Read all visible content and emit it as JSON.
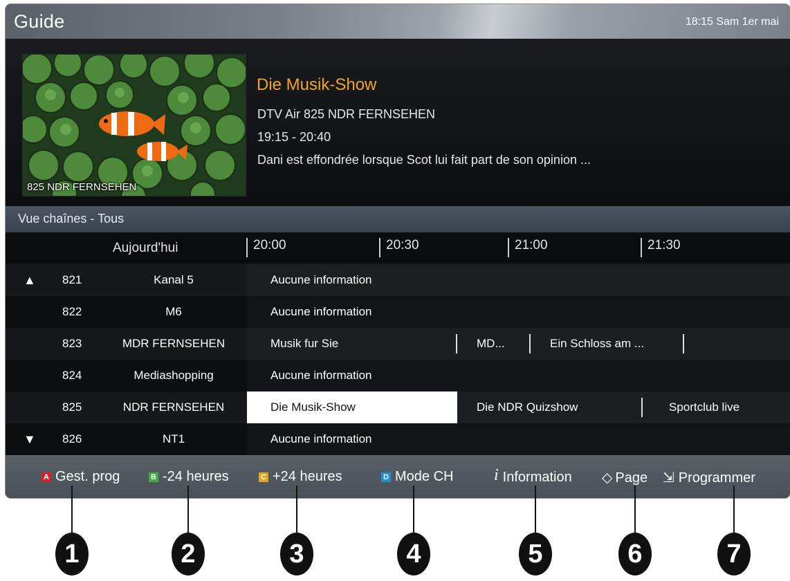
{
  "header": {
    "title": "Guide",
    "clock": "18:15 Sam 1er mai"
  },
  "preview": {
    "channel_label": "825 NDR FERNSEHEN",
    "program_title": "Die Musik-Show",
    "channel_info": "DTV Air 825 NDR FERNSEHEN",
    "time_range": "19:15 - 20:40",
    "description": "Dani est effondrée lorsque Scot lui fait part de son opinion ..."
  },
  "section": {
    "label": "Vue chaînes - Tous"
  },
  "timeline": {
    "today": "Aujourd'hui",
    "slots": [
      "20:00",
      "20:30",
      "21:00",
      "21:30"
    ]
  },
  "channels": [
    {
      "arrow": "▲",
      "num": "821",
      "name": "Kanal 5",
      "programs": [
        "Aucune information"
      ]
    },
    {
      "arrow": "",
      "num": "822",
      "name": "M6",
      "programs": [
        "Aucune information"
      ]
    },
    {
      "arrow": "",
      "num": "823",
      "name": "MDR FERNSEHEN",
      "programs": [
        "Musik fur Sie",
        "MD...",
        "Ein Schloss am ..."
      ]
    },
    {
      "arrow": "",
      "num": "824",
      "name": "Mediashopping",
      "programs": [
        "Aucune information"
      ]
    },
    {
      "arrow": "",
      "num": "825",
      "name": "NDR FERNSEHEN",
      "programs": [
        "Die Musik-Show",
        "Die NDR Quizshow",
        "Sportclub live"
      ],
      "selected": "Die Musik-Show"
    },
    {
      "arrow": "▼",
      "num": "826",
      "name": "NT1",
      "programs": [
        "Aucune information"
      ]
    }
  ],
  "footer": {
    "items": [
      {
        "key": "A",
        "label": "Gest. prog",
        "key_color": "#d4212b"
      },
      {
        "key": "B",
        "label": "-24 heures",
        "key_color": "#3fae3f"
      },
      {
        "key": "C",
        "label": "+24 heures",
        "key_color": "#e3a21f"
      },
      {
        "key": "D",
        "label": "Mode CH",
        "key_color": "#1d8fd6"
      },
      {
        "icon": "info-icon",
        "glyph": "i",
        "label": "Information"
      },
      {
        "icon": "page-updown-icon",
        "glyph": "◇",
        "label": "Page"
      },
      {
        "icon": "enter-icon",
        "glyph": "⇲",
        "label": "Programmer"
      }
    ]
  },
  "callouts": [
    "1",
    "2",
    "3",
    "4",
    "5",
    "6",
    "7"
  ],
  "colors": {
    "accent_title": "#f0a52a",
    "selected_cell": "#ffffff"
  }
}
